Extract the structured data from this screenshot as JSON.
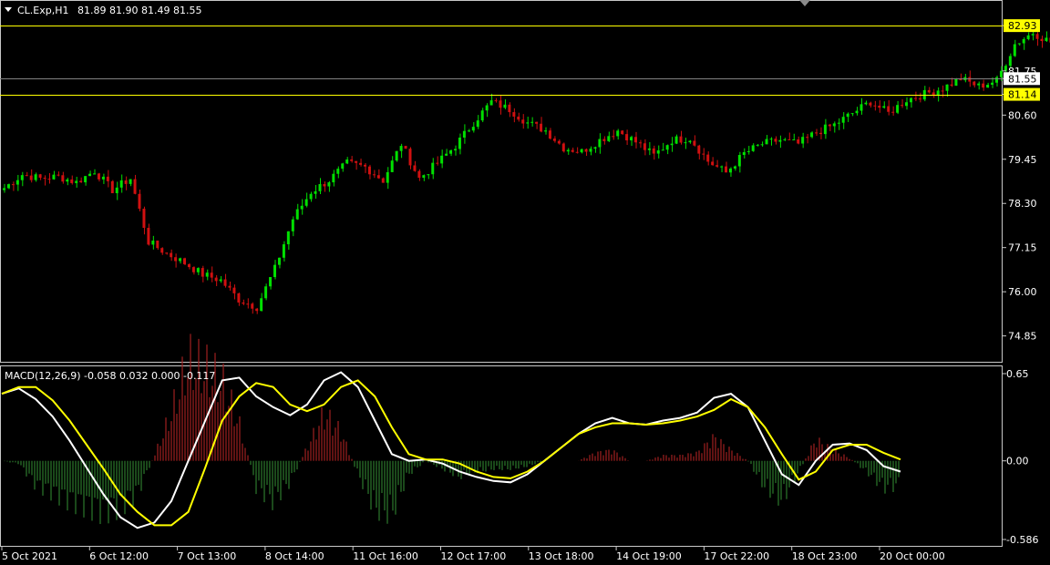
{
  "header": {
    "symbol_label": "CL.Exp,H1",
    "ohlc_label": "81.89 81.90 81.49 81.55"
  },
  "macd_header": "MACD(12,26,9) -0.058 0.032 0.000 -0.117",
  "colors": {
    "background": "#000000",
    "bull": "#00e000",
    "bear": "#d01010",
    "level_line": "#ffff00",
    "price_line": "#808080",
    "macd_main": "#ffffff",
    "macd_signal": "#ffff00",
    "hist_pos": "#a02020",
    "hist_neg": "#2d7a2d",
    "frame": "#c8c8c8"
  },
  "chart_data": [
    {
      "type": "candlestick",
      "title": "CL.Exp,H1",
      "ylim": [
        74.2,
        83.55
      ],
      "y_ticks": [
        "82.93",
        "81.75",
        "81.55",
        "81.14",
        "80.60",
        "79.45",
        "78.30",
        "77.15",
        "76.00",
        "74.85"
      ],
      "levels": [
        82.93,
        81.14
      ],
      "current_price": 81.55,
      "level_labels": [
        "82.93",
        "81.14"
      ],
      "current_price_label": "81.55",
      "x_labels": [
        "5 Oct 2021",
        "6 Oct 12:00",
        "7 Oct 13:00",
        "8 Oct 14:00",
        "11 Oct 16:00",
        "12 Oct 17:00",
        "13 Oct 18:00",
        "14 Oct 19:00",
        "17 Oct 22:00",
        "18 Oct 23:00",
        "20 Oct 00:00"
      ],
      "close_anchors": [
        78.7,
        79.05,
        78.95,
        79.0,
        78.85,
        79.15,
        78.65,
        78.95,
        77.3,
        77.0,
        76.75,
        76.45,
        76.3,
        75.8,
        75.6,
        76.6,
        77.9,
        78.6,
        78.9,
        79.35,
        79.25,
        78.9,
        79.85,
        78.95,
        79.35,
        79.8,
        80.4,
        80.95,
        80.75,
        80.4,
        80.2,
        79.75,
        79.65,
        79.95,
        80.2,
        79.9,
        79.55,
        79.95,
        80.0,
        79.4,
        79.1,
        79.6,
        79.85,
        79.95,
        79.85,
        80.15,
        80.35,
        80.65,
        80.95,
        80.65,
        81.0,
        81.15,
        81.3,
        81.55,
        81.35,
        81.5,
        82.45,
        82.75,
        82.5,
        82.65,
        81.5,
        81.4,
        81.4,
        81.65,
        82.05,
        82.4,
        82.55,
        81.55,
        82.15,
        81.95,
        82.05,
        81.75,
        81.55
      ],
      "projection": [
        81.55,
        81.2,
        82.3,
        81.65,
        82.45,
        81.95,
        83.55
      ],
      "projection_color": "#ffff00"
    },
    {
      "type": "line",
      "title": "MACD(12,26,9)",
      "ylim": [
        -0.586,
        0.65
      ],
      "y_ticks": [
        "0.65",
        "0.00",
        "-0.586"
      ],
      "series": [
        {
          "color": "#ffffff",
          "values": [
            0.5,
            0.54,
            0.46,
            0.33,
            0.15,
            -0.05,
            -0.25,
            -0.42,
            -0.5,
            -0.46,
            -0.3,
            0.0,
            0.3,
            0.6,
            0.62,
            0.48,
            0.4,
            0.34,
            0.42,
            0.6,
            0.66,
            0.55,
            0.3,
            0.05,
            0.0,
            0.01,
            -0.02,
            -0.08,
            -0.12,
            -0.15,
            -0.16,
            -0.1,
            0.0,
            0.1,
            0.2,
            0.28,
            0.32,
            0.28,
            0.27,
            0.3,
            0.32,
            0.36,
            0.47,
            0.5,
            0.4,
            0.15,
            -0.1,
            -0.18,
            0.0,
            0.12,
            0.13,
            0.08,
            -0.04,
            -0.08
          ]
        },
        {
          "color": "#ffff00",
          "values": [
            0.5,
            0.55,
            0.55,
            0.45,
            0.3,
            0.12,
            -0.06,
            -0.25,
            -0.38,
            -0.48,
            -0.48,
            -0.38,
            -0.05,
            0.3,
            0.48,
            0.58,
            0.55,
            0.42,
            0.37,
            0.42,
            0.55,
            0.6,
            0.48,
            0.25,
            0.05,
            0.01,
            0.01,
            -0.02,
            -0.08,
            -0.12,
            -0.13,
            -0.08,
            0.0,
            0.1,
            0.2,
            0.25,
            0.28,
            0.28,
            0.27,
            0.28,
            0.3,
            0.33,
            0.38,
            0.46,
            0.4,
            0.25,
            0.05,
            -0.14,
            -0.08,
            0.08,
            0.12,
            0.12,
            0.06,
            0.01
          ]
        }
      ]
    }
  ]
}
